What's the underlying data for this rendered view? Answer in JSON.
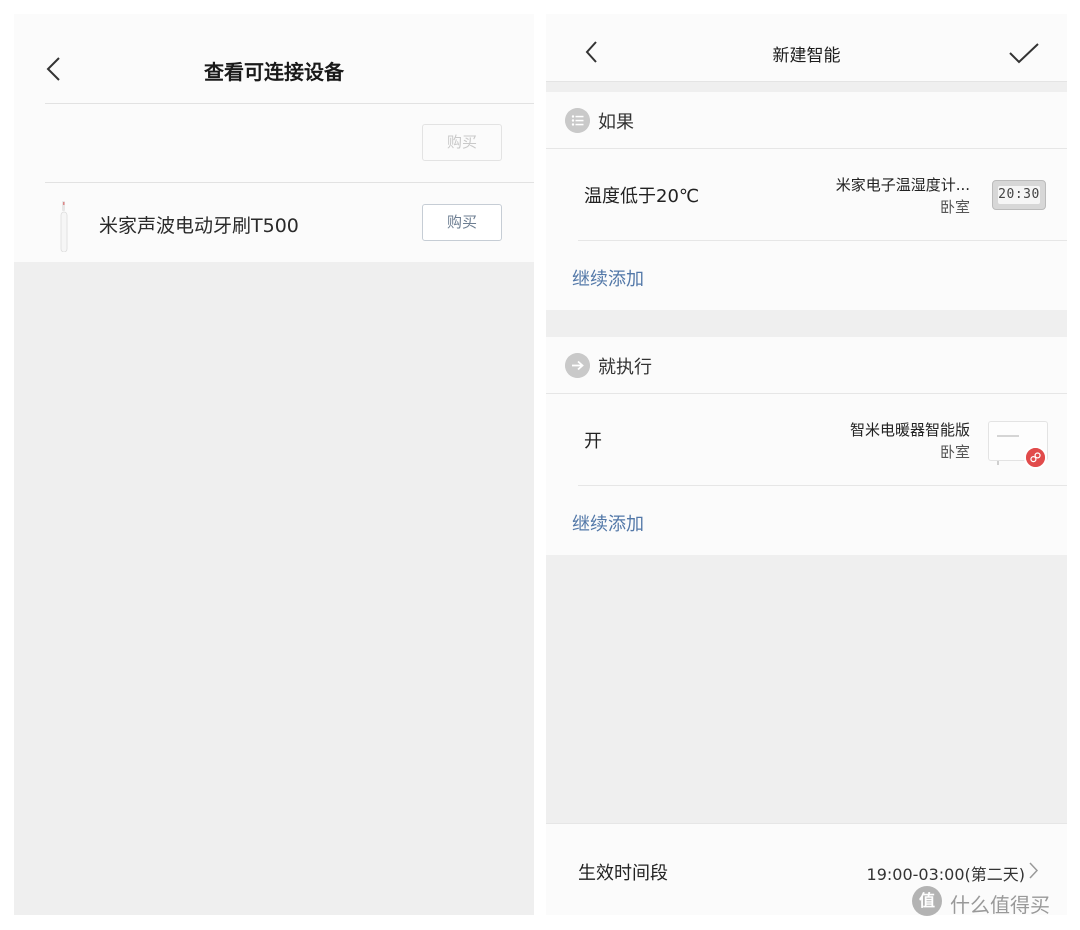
{
  "left": {
    "title": "查看可连接设备",
    "rows": [
      {
        "name": "",
        "buy_label": "购买"
      },
      {
        "name": "米家声波电动牙刷T500",
        "buy_label": "购买"
      }
    ]
  },
  "right": {
    "title": "新建智能",
    "if_section": {
      "label": "如果",
      "condition": "温度低于20℃",
      "device": "米家电子温湿度计...",
      "room": "卧室",
      "clock_display": "20:30",
      "add_label": "继续添加"
    },
    "then_section": {
      "label": "就执行",
      "action": "开",
      "device": "智米电暖器智能版",
      "room": "卧室",
      "add_label": "继续添加"
    },
    "effective_time": {
      "label": "生效时间段",
      "value": "19:00-03:00(第二天)"
    }
  },
  "watermark": {
    "glyph": "值",
    "text": "什么值得买"
  },
  "colors": {
    "link_blue": "#5378a8",
    "badge_red": "#e14b4b",
    "panel_bg": "#efefef",
    "card_bg": "#fbfbfb"
  },
  "icons": [
    "chevron-left-icon",
    "checkmark-icon",
    "list-icon",
    "arrow-right-icon",
    "link-icon",
    "chevron-right-icon"
  ]
}
